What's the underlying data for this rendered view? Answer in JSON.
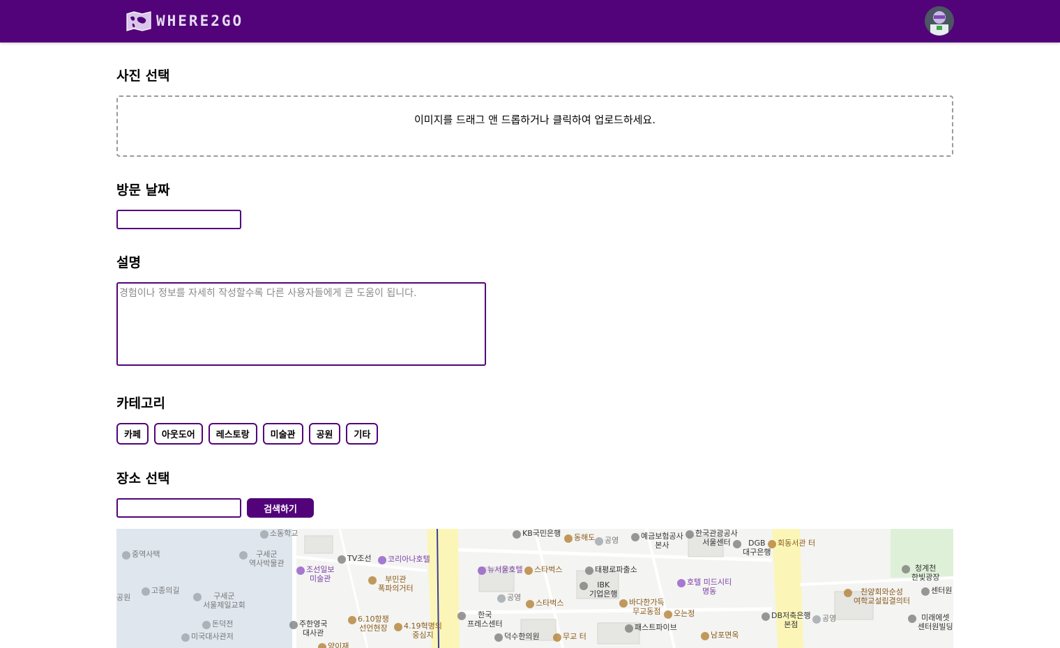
{
  "header": {
    "logo_text": "WHERE2GO",
    "logo_icon": "world-map-icon",
    "brand_color": "#52037a"
  },
  "sections": {
    "photo_title": "사진 선택",
    "photo_hint": "이미지를 드래그 앤 드롭하거나 클릭하여 업로드하세요.",
    "date_title": "방문 날짜",
    "date_value": "",
    "description_title": "설명",
    "description_placeholder": "경험이나 정보를 자세히 작성할수록 다른 사용자들에게 큰 도움이 됩니다.",
    "category_title": "카테고리",
    "place_title": "장소 선택",
    "place_value": "",
    "search_button": "검색하기"
  },
  "categories": [
    "카페",
    "아웃도어",
    "레스토랑",
    "미술관",
    "공원",
    "기타"
  ],
  "map": {
    "labels": [
      {
        "text": "KB국민은행",
        "cls": "lbl-poi"
      },
      {
        "text": "동해도",
        "cls": "lbl-brown"
      },
      {
        "text": "공영",
        "cls": "lbl-gray"
      },
      {
        "text": "예금보험공사\n본사",
        "cls": "lbl-poi"
      },
      {
        "text": "한국관광공사\n서울센터",
        "cls": "lbl-poi"
      },
      {
        "text": "DGB\n대구은행",
        "cls": "lbl-poi"
      },
      {
        "text": "회동서관 터",
        "cls": "lbl-brown"
      },
      {
        "text": "청계천\n한빛광장",
        "cls": "lbl-poi"
      },
      {
        "text": "중역사택",
        "cls": "lbl-gray"
      },
      {
        "text": "구세군\n역사박물관",
        "cls": "lbl-gray"
      },
      {
        "text": "TV조선",
        "cls": "lbl-poi"
      },
      {
        "text": "코리아나호텔",
        "cls": "lbl-purple"
      },
      {
        "text": "조선일보\n미술관",
        "cls": "lbl-purple"
      },
      {
        "text": "뉴서울호텔",
        "cls": "lbl-purple"
      },
      {
        "text": "스타벅스",
        "cls": "lbl-brown"
      },
      {
        "text": "태평로파출소",
        "cls": "lbl-poi"
      },
      {
        "text": "IBK\n기업은행",
        "cls": "lbl-poi"
      },
      {
        "text": "호텔 미드시티\n명동",
        "cls": "lbl-purple"
      },
      {
        "text": "고종의길",
        "cls": "lbl-gray"
      },
      {
        "text": "구세군\n서울제일교회",
        "cls": "lbl-gray"
      },
      {
        "text": "부민관\n폭파의거터",
        "cls": "lbl-brown"
      },
      {
        "text": "공영",
        "cls": "lbl-gray"
      },
      {
        "text": "스타벅스",
        "cls": "lbl-brown"
      },
      {
        "text": "바다한가득\n무교동점",
        "cls": "lbl-brown"
      },
      {
        "text": "오는정",
        "cls": "lbl-brown"
      },
      {
        "text": "찬양회와순성\n여학교설립결의터",
        "cls": "lbl-brown"
      },
      {
        "text": "센터원",
        "cls": "lbl-poi"
      },
      {
        "text": "공원",
        "cls": "lbl-gray"
      },
      {
        "text": "돈덕전",
        "cls": "lbl-gray"
      },
      {
        "text": "주한영국\n대사관",
        "cls": "lbl-poi"
      },
      {
        "text": "6.10항쟁\n선언현장",
        "cls": "lbl-brown"
      },
      {
        "text": "4.19혁명의\n중심지",
        "cls": "lbl-brown"
      },
      {
        "text": "한국\n프레스센터",
        "cls": "lbl-poi"
      },
      {
        "text": "DB저축은행\n본점",
        "cls": "lbl-poi"
      },
      {
        "text": "공영",
        "cls": "lbl-gray"
      },
      {
        "text": "미래에셋\n센터원빌딩",
        "cls": "lbl-poi"
      },
      {
        "text": "미국대사관저",
        "cls": "lbl-gray"
      },
      {
        "text": "덕수한의원",
        "cls": "lbl-poi"
      },
      {
        "text": "무교 터",
        "cls": "lbl-brown"
      },
      {
        "text": "패스트파이브",
        "cls": "lbl-poi"
      },
      {
        "text": "남포면옥",
        "cls": "lbl-brown"
      },
      {
        "text": "양이재",
        "cls": "lbl-brown"
      },
      {
        "text": "소동학교",
        "cls": "lbl-gray"
      }
    ]
  }
}
